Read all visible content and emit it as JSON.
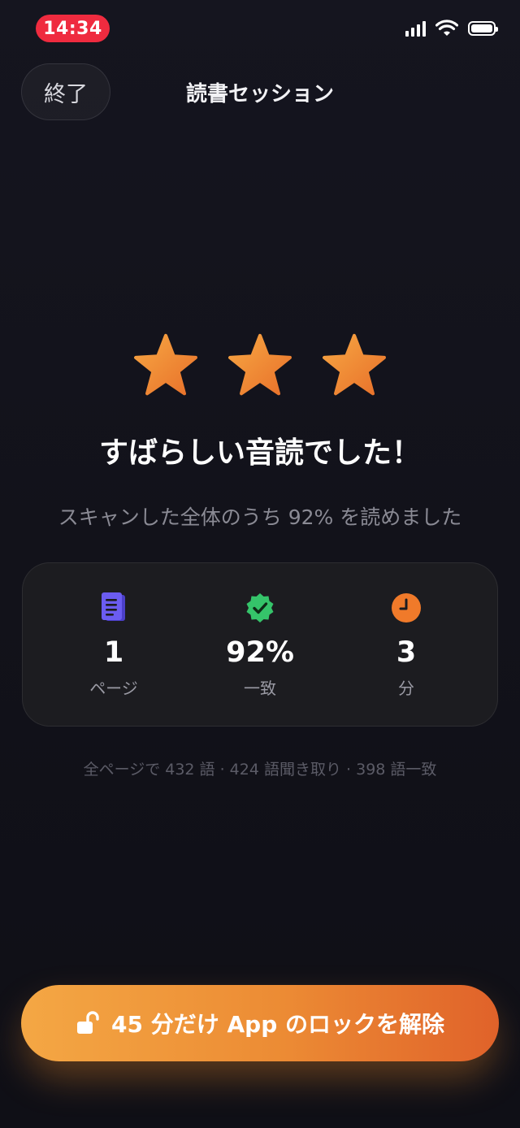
{
  "status_bar": {
    "time": "14:34",
    "time_pill_color": "#ef2b3f",
    "icons": [
      "signal-icon",
      "wifi-icon",
      "battery-icon"
    ]
  },
  "header": {
    "exit_label": "終了",
    "title": "読書セッション"
  },
  "result": {
    "stars_total": 3,
    "stars_filled": 3,
    "star_color": "#f08c2e",
    "headline": "すばらしい音読でした！",
    "subline": "スキャンした全体のうち 92% を読めました"
  },
  "stats": [
    {
      "icon": "document-icon",
      "icon_color": "#6b5cf0",
      "value": "1",
      "label": "ページ"
    },
    {
      "icon": "verified-check-icon",
      "icon_color": "#35c46a",
      "value": "92%",
      "label": "一致"
    },
    {
      "icon": "clock-icon",
      "icon_color": "#f07a2a",
      "value": "3",
      "label": "分"
    }
  ],
  "summary": "全ページで 432 語 · 424 語聞き取り · 398 語一致",
  "unlock_button": {
    "label": "45 分だけ App のロックを解除",
    "icon": "unlock-icon",
    "gradient": [
      "#f4a744",
      "#e0622a"
    ]
  }
}
